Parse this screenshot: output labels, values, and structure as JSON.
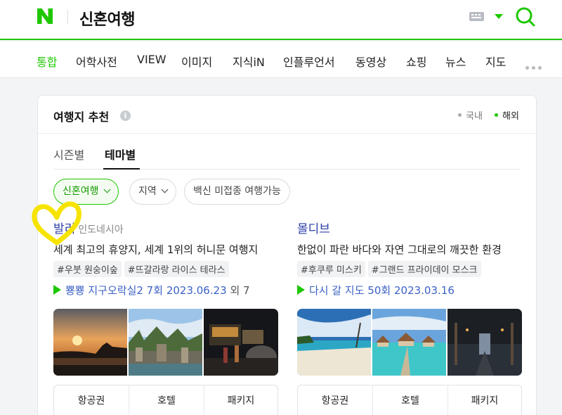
{
  "header": {
    "logo_letter": "N",
    "logo_color": "#1ec800",
    "query": "신혼여행",
    "keyboard_icon": "keyboard-icon",
    "search_icon": "search-icon"
  },
  "tabs": [
    {
      "label": "통합",
      "active": true
    },
    {
      "label": "어학사전"
    },
    {
      "label": "VIEW"
    },
    {
      "label": "이미지"
    },
    {
      "label": "지식iN"
    },
    {
      "label": "인플루언서"
    },
    {
      "label": "동영상"
    },
    {
      "label": "쇼핑"
    },
    {
      "label": "뉴스"
    },
    {
      "label": "지도"
    }
  ],
  "card": {
    "title": "여행지 추천",
    "regions": [
      {
        "label": "국내",
        "active": false
      },
      {
        "label": "해외",
        "active": true
      }
    ],
    "subtabs": [
      {
        "label": "시즌별",
        "active": false
      },
      {
        "label": "테마별",
        "active": true
      }
    ],
    "filters": [
      {
        "label": "신혼여행",
        "active": true
      },
      {
        "label": "지역"
      },
      {
        "label": "백신 미접종 여행가능"
      }
    ],
    "destinations": [
      {
        "name": "발리",
        "country": "인도네시아",
        "description": "세계 최고의 휴양지, 세계 1위의 허니문 여행지",
        "tags": [
          "#우붓 원숭이숲",
          "#뜨갈라랑 라이스 테라스"
        ],
        "tv_program": "뿅뿅 지구오락실2 7회",
        "tv_date": "2023.06.23",
        "tv_extra": "외 7",
        "buttons": [
          "항공권",
          "호텔",
          "패키지"
        ]
      },
      {
        "name": "몰디브",
        "country": "",
        "description": "한없이 파란 바다와 자연 그대로의 깨끗한 환경",
        "tags": [
          "#후쿠루 미스키",
          "#그랜드 프라이데이 모스크"
        ],
        "tv_program": "다시 갈 지도 50회",
        "tv_date": "2023.03.16",
        "tv_extra": "",
        "buttons": [
          "항공권",
          "호텔",
          "패키지"
        ]
      }
    ]
  },
  "colors": {
    "brand_green": "#1ec800",
    "link_blue": "#2b3fa8",
    "heart_yellow": "#f6e400"
  }
}
